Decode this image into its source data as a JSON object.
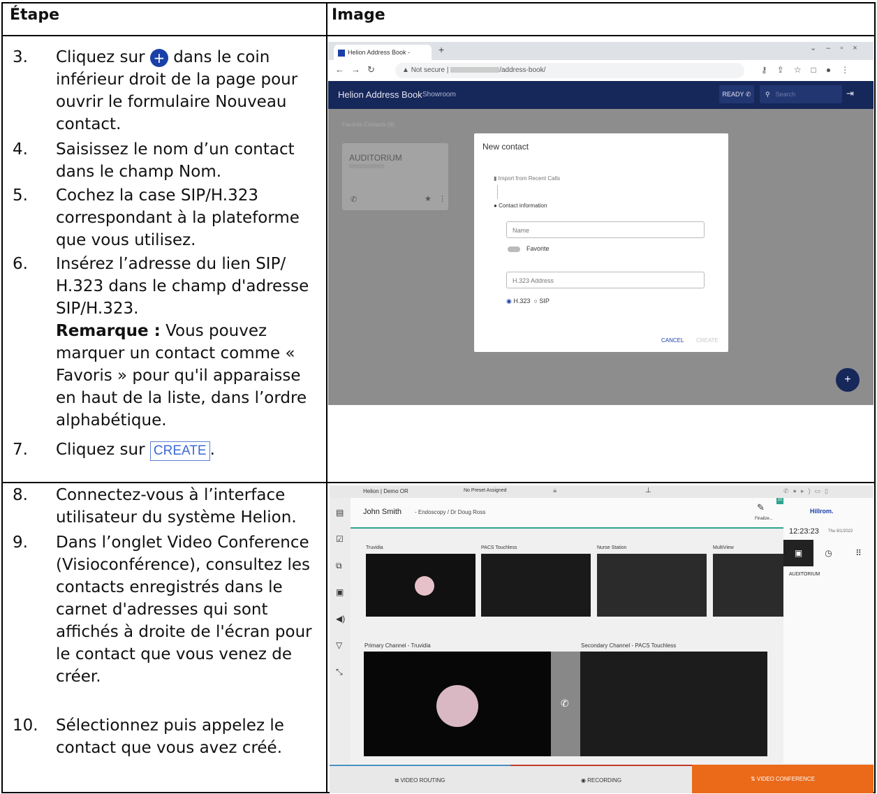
{
  "header": {
    "col_step": "Étape",
    "col_image": "Image"
  },
  "steps": [
    {
      "num": "3.",
      "pre": "Cliquez sur",
      "post": "dans le coin inférieur droit de la page pour ouvrir le formulaire Nouveau contact."
    },
    {
      "num": "4.",
      "text": "Saisissez le nom d’un contact dans le champ Nom."
    },
    {
      "num": "5.",
      "text": "Cochez la case SIP/H.323 correspondant à la plateforme que vous utilisez."
    },
    {
      "num": "6.",
      "text": "Insérez l’adresse du lien SIP/ H.323 dans le champ d'adresse SIP/H.323.",
      "note_label": "Remarque :",
      "note_text": "Vous pouvez marquer un contact comme « Favoris » pour qu'il apparaisse en haut de la liste, dans l’ordre alphabétique."
    },
    {
      "num": "7.",
      "pre": "Cliquez sur",
      "button": "CREATE",
      "post": "."
    },
    {
      "num": "8.",
      "text": "Connectez-vous à l’interface utilisateur du système Helion."
    },
    {
      "num": "9.",
      "text": "Dans l’onglet Video Conference (Visioconférence), consultez les contacts enregistrés dans le carnet d'adresses qui sont affichés à droite de l'écran pour le contact que vous venez de créer."
    },
    {
      "num": "10.",
      "text": "Sélectionnez puis appelez le contact que vous avez créé."
    }
  ],
  "plus_symbol": "+",
  "shot1": {
    "tab_title": "Helion Address Book - Showro",
    "url_warning": "Not secure",
    "url_path": "/address-book/",
    "app_title": "Helion Address Book",
    "app_subtitle": "Showroom",
    "ready": "READY",
    "search_placeholder": "Search",
    "favorites": "Favorite Contacts (9)",
    "card_name": "AUDITORIUM",
    "dialog_title": "New contact",
    "import": "Import from Recent Calls",
    "contact_info": "Contact information",
    "name_placeholder": "Name",
    "favorite": "Favorite",
    "address_placeholder": "H.323 Address",
    "opt_h323": "H.323",
    "opt_sip": "SIP",
    "cancel": "CANCEL",
    "create": "CREATE",
    "fab": "+"
  },
  "shot2": {
    "room": "Helion | Demo OR",
    "preset": "No Preset Assigned",
    "patient": "John Smith",
    "procedure": "- Endoscopy / Dr Doug Ross",
    "finalize": "Finalize...",
    "badge": "10",
    "brand": "Hillrom.",
    "time": "12:23:23",
    "date": "Thu 9/1/2022",
    "contact": "AUDITORIUM",
    "sources": [
      "Truvidia",
      "PACS Touchless",
      "Nurse Station",
      "MultiView"
    ],
    "primary": "Primary Channel - Truvidia",
    "secondary": "Secondary Channel - PACS Touchless",
    "tab_routing": "VIDEO ROUTING",
    "tab_recording": "RECORDING",
    "tab_conference": "VIDEO CONFERENCE"
  },
  "colors": {
    "accent": "#ea6a1a",
    "navy": "#16275a",
    "teal": "#2fa38f",
    "red": "#c0392b"
  }
}
